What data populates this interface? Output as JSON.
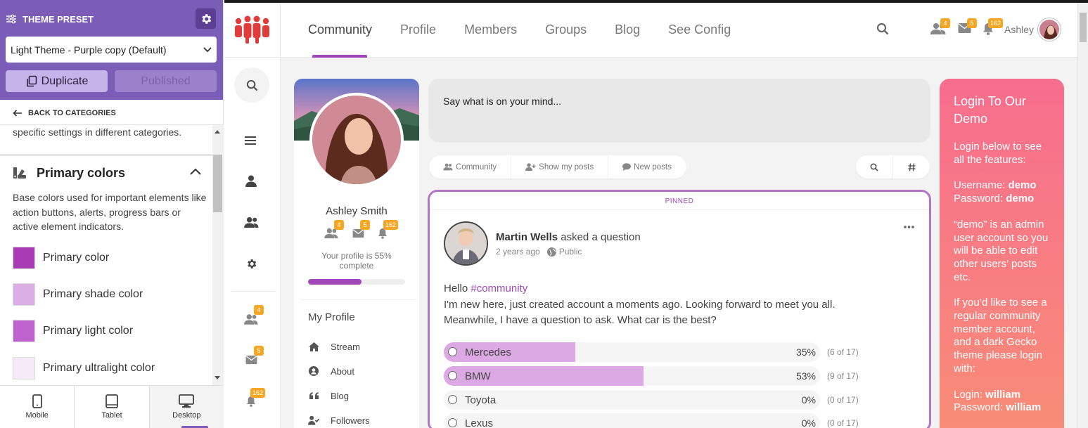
{
  "customizer": {
    "title": "THEME PRESET",
    "select_value": "Light Theme - Purple copy (Default)",
    "duplicate_label": "Duplicate",
    "published_label": "Published",
    "back_label": "BACK TO CATEGORIES",
    "prev_text": "specific settings in different categories.",
    "section_title": "Primary colors",
    "section_desc": "Base colors used for important elements like action buttons, alerts, progress bars or active element indicators.",
    "colors": [
      {
        "label": "Primary color",
        "value": "#a83bb5"
      },
      {
        "label": "Primary shade color",
        "value": "#dcaee6"
      },
      {
        "label": "Primary light color",
        "value": "#bf62cf"
      },
      {
        "label": "Primary ultralight color",
        "value": "#f6eaf9"
      }
    ],
    "devices": [
      {
        "label": "Mobile",
        "icon": "mobile-icon"
      },
      {
        "label": "Tablet",
        "icon": "tablet-icon"
      },
      {
        "label": "Desktop",
        "icon": "desktop-icon"
      }
    ]
  },
  "header": {
    "nav": [
      "Community",
      "Profile",
      "Members",
      "Groups",
      "Blog",
      "See Config"
    ],
    "active_nav": "Community",
    "friends_count": "4",
    "messages_count": "5",
    "notifications_count": "162",
    "user_name": "Ashley"
  },
  "rail": {
    "friends_count": "4",
    "messages_count": "5",
    "notifications_count": "162"
  },
  "profile_card": {
    "name": "Ashley Smith",
    "friends_count": "4",
    "messages_count": "5",
    "notifications_count": "162",
    "complete_text": "Your profile is 55% complete",
    "progress": 0.55,
    "menu_title": "My Profile",
    "menu": [
      {
        "label": "Stream",
        "icon": "home-icon"
      },
      {
        "label": "About",
        "icon": "user-circle-icon"
      },
      {
        "label": "Blog",
        "icon": "quote-icon"
      },
      {
        "label": "Followers",
        "icon": "user-check-icon"
      }
    ]
  },
  "composer": {
    "placeholder": "Say what is on your mind..."
  },
  "filters": [
    "Community",
    "Show my posts",
    "New posts"
  ],
  "post": {
    "pinned_label": "PINNED",
    "author": "Martin Wells",
    "action": "asked a question",
    "time": "2 years ago",
    "visibility": "Public",
    "line1_prefix": "Hello ",
    "hashtag": "#community",
    "line2": "I'm new here, just created account a moments ago. Looking forward to meet you all.",
    "line3": "Meanwhile, I have a question to ask. What car is the best?",
    "poll": [
      {
        "label": "Mercedes",
        "pct": "35%",
        "count": "(6 of 17)",
        "value": 0.35
      },
      {
        "label": "BMW",
        "pct": "53%",
        "count": "(9 of 17)",
        "value": 0.53
      },
      {
        "label": "Toyota",
        "pct": "0%",
        "count": "(0 of 17)",
        "value": 0
      },
      {
        "label": "Lexus",
        "pct": "0%",
        "count": "(0 of 17)",
        "value": 0
      }
    ]
  },
  "login_card": {
    "title": "Login To Our Demo",
    "intro": "Login below to see all the features:",
    "username_label": "Username:",
    "username_value": "demo",
    "password_label": "Password:",
    "password_value": "demo",
    "admin_note_prefix": "“demo” is an admin user account so you will be able to edit other users’ posts etc.",
    "regular_note": "If you’d like to see a regular community member account, and a dark Gecko theme please login with:",
    "login2_label": "Login:",
    "login2_value": "william",
    "password2_label": "Password:",
    "password2_value": "william"
  },
  "colors": {
    "accent": "#a147b7",
    "customizer_header": "#7b5cb7",
    "badge": "#f5a623",
    "login_gradient_top": "#f76d8e",
    "login_gradient_bottom": "#f88c77"
  }
}
